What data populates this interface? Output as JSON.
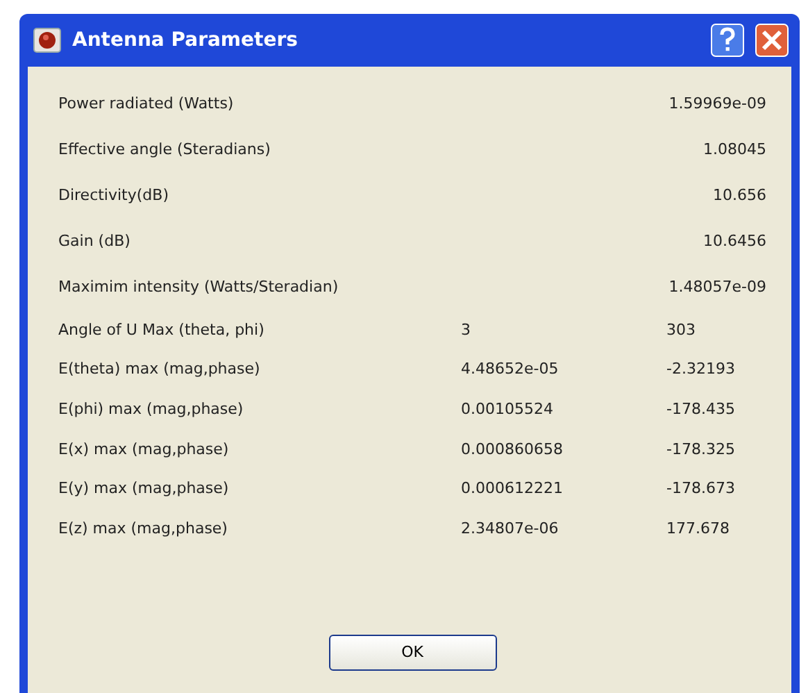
{
  "window": {
    "title": "Antenna Parameters"
  },
  "rows": [
    {
      "kind": "single",
      "label": "Power radiated (Watts)",
      "value": "1.59969e-09"
    },
    {
      "kind": "single",
      "label": "Effective angle (Steradians)",
      "value": "1.08045"
    },
    {
      "kind": "single",
      "label": "Directivity(dB)",
      "value": "10.656"
    },
    {
      "kind": "single",
      "label": "Gain (dB)",
      "value": "10.6456"
    },
    {
      "kind": "single",
      "label": "Maximim intensity (Watts/Steradian)",
      "value": "1.48057e-09"
    },
    {
      "kind": "pair",
      "label": "Angle of U Max (theta, phi)",
      "value": "3",
      "value_2": "303"
    },
    {
      "kind": "pair",
      "label": "E(theta) max (mag,phase)",
      "value": "4.48652e-05",
      "value_2": "-2.32193"
    },
    {
      "kind": "pair",
      "label": "E(phi) max (mag,phase)",
      "value": "0.00105524",
      "value_2": "-178.435"
    },
    {
      "kind": "pair",
      "label": "E(x) max (mag,phase)",
      "value": "0.000860658",
      "value_2": "-178.325"
    },
    {
      "kind": "pair",
      "label": "E(y) max (mag,phase)",
      "value": "0.000612221",
      "value_2": "-178.673"
    },
    {
      "kind": "pair",
      "label": "E(z) max (mag,phase)",
      "value": "2.34807e-06",
      "value_2": "177.678"
    }
  ],
  "buttons": [
    "OK"
  ]
}
